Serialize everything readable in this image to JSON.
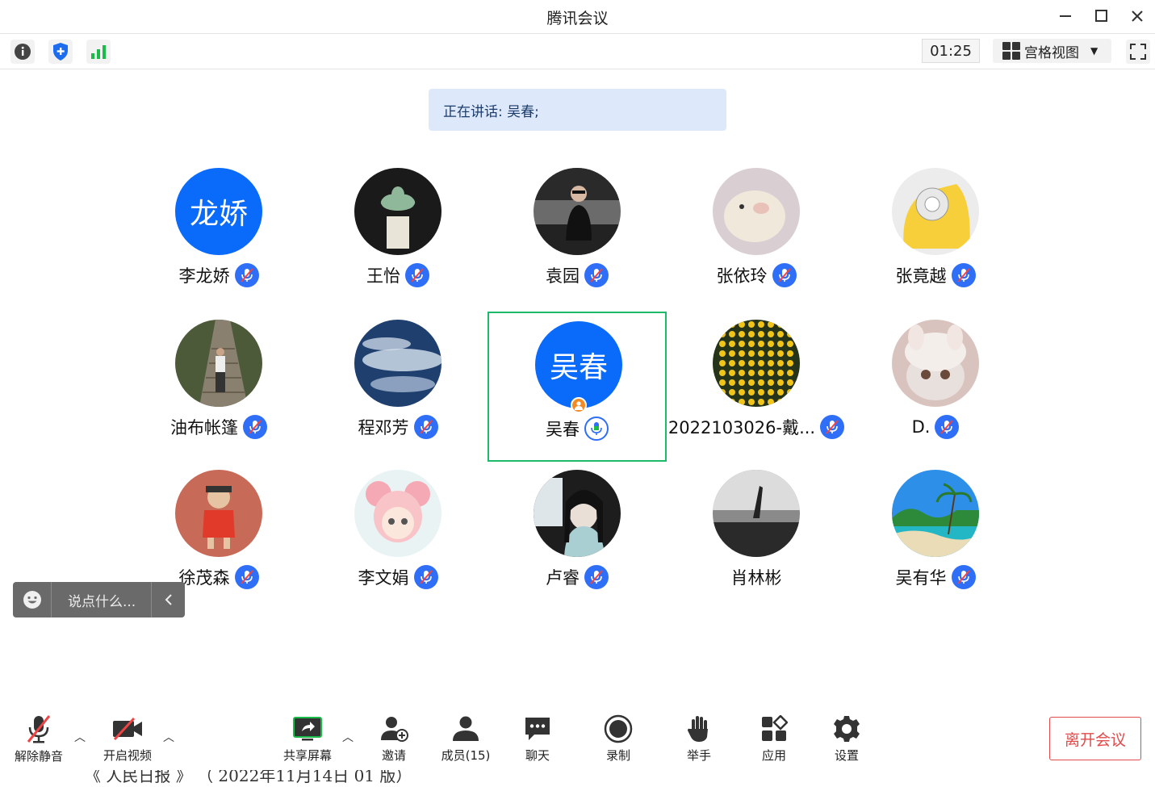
{
  "window": {
    "title": "腾讯会议"
  },
  "toolbar": {
    "timer": "01:25",
    "view_label": "宫格视图"
  },
  "speaking": {
    "text": "正在讲话: 吴春;"
  },
  "participants": [
    {
      "name": "李龙娇",
      "avatar_text": "龙娇",
      "avatar_kind": "text",
      "mic": "muted"
    },
    {
      "name": "王怡",
      "avatar_kind": "photo-succulent",
      "mic": "muted"
    },
    {
      "name": "袁园",
      "avatar_kind": "photo-woman-car",
      "mic": "muted"
    },
    {
      "name": "张依玲",
      "avatar_kind": "photo-puppy",
      "mic": "muted"
    },
    {
      "name": "张竟越",
      "avatar_kind": "photo-cartoon-yellow",
      "mic": "muted"
    },
    {
      "name": "油布帐篷",
      "avatar_kind": "photo-stairs",
      "mic": "muted"
    },
    {
      "name": "程邓芳",
      "avatar_kind": "photo-sky",
      "mic": "muted"
    },
    {
      "name": "吴春",
      "avatar_text": "吴春",
      "avatar_kind": "text",
      "mic": "speaking",
      "host": true,
      "selected": true
    },
    {
      "name": "2022103026-戴...",
      "avatar_kind": "photo-flowers",
      "mic": "muted"
    },
    {
      "name": "D.",
      "avatar_kind": "photo-cat",
      "mic": "muted"
    },
    {
      "name": "徐茂森",
      "avatar_kind": "photo-child-red",
      "mic": "muted"
    },
    {
      "name": "李文娟",
      "avatar_kind": "photo-anime-girl",
      "mic": "muted"
    },
    {
      "name": "卢睿",
      "avatar_kind": "photo-girl-bw",
      "mic": "muted"
    },
    {
      "name": "肖林彬",
      "avatar_kind": "photo-bw-hand",
      "mic": "none"
    },
    {
      "name": "吴有华",
      "avatar_kind": "photo-beach",
      "mic": "muted"
    }
  ],
  "chat": {
    "placeholder": "说点什么..."
  },
  "bottombar": {
    "unmute": "解除静音",
    "start_video": "开启视频",
    "share_screen": "共享屏幕",
    "invite": "邀请",
    "members": "成员(15)",
    "chat": "聊天",
    "record": "录制",
    "raise_hand": "举手",
    "apps": "应用",
    "settings": "设置",
    "leave": "离开会议"
  },
  "background_strip": {
    "text": "《 人民日报 》 （ 2022年11月14日  01  版）"
  },
  "colors": {
    "accent_blue": "#0a6bfb",
    "mic_blue": "#2f6ef7",
    "selected_green": "#1bbb6a",
    "leave_red": "#e14b4b",
    "banner_bg": "#dde9fb"
  }
}
